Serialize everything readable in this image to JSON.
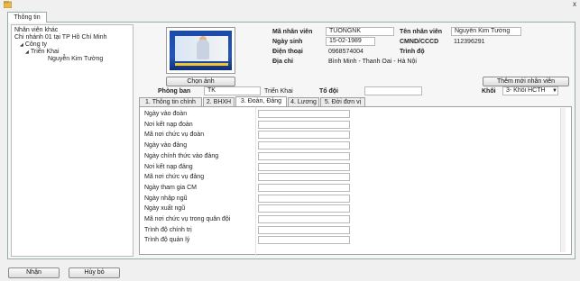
{
  "window": {
    "close_glyph": "x",
    "icon": "app-icon"
  },
  "outer_tab": "Thông tin",
  "tree": {
    "items": [
      {
        "label": "Nhân viên khác",
        "level": 0,
        "expanded": null
      },
      {
        "label": "Chi nhánh 01 tại TP Hồ Chí Minh",
        "level": 0,
        "expanded": null
      },
      {
        "label": "Công ty",
        "level": 0,
        "expanded": true
      },
      {
        "label": "Triển Khai",
        "level": 1,
        "expanded": true
      },
      {
        "label": "Nguyễn Kim Tường",
        "level": 2,
        "expanded": null
      }
    ],
    "arrow_glyph": "◢"
  },
  "photo_button": "Chọn ảnh",
  "add_employee_button": "Thêm mới nhân viên",
  "employee": {
    "ma_nv_label": "Mã nhân viên",
    "ma_nv": "TUONGNK",
    "ten_nv_label": "Tên nhân viên",
    "ten_nv": "Nguyễn Kim Tường",
    "ngay_sinh_label": "Ngày sinh",
    "ngay_sinh": "15-02-1989",
    "cmnd_label": "CMND/CCCD",
    "cmnd": "112396291",
    "dien_thoai_label": "Điện thoại",
    "dien_thoai": "0968574004",
    "trinh_do_label": "Trình độ",
    "trinh_do": "",
    "dia_chi_label": "Địa chỉ",
    "dia_chi": "Bình Minh - Thanh Oai - Hà Nội"
  },
  "org": {
    "phong_ban_label": "Phòng ban",
    "phong_ban_code": "TK",
    "phong_ban_name": "Triển Khai",
    "to_doi_label": "Tổ đội",
    "to_doi": "",
    "khoi_label": "Khối",
    "khoi": "3- Khối HCTH",
    "dropdown_glyph": "▼"
  },
  "tabs": [
    {
      "label": "1. Thông tin chính",
      "active": false
    },
    {
      "label": "2. BHXH",
      "active": false
    },
    {
      "label": "3. Đoàn, Đảng",
      "active": true
    },
    {
      "label": "4. Lương",
      "active": false
    },
    {
      "label": "5. Đời đơn vị",
      "active": false
    }
  ],
  "fields": [
    {
      "label": "Ngày vào đoàn",
      "value": ""
    },
    {
      "label": "Nơi kết nạp đoàn",
      "value": ""
    },
    {
      "label": "Mã nơi chức vụ đoàn",
      "value": ""
    },
    {
      "label": "Ngày vào đảng",
      "value": ""
    },
    {
      "label": "Ngày chính thức vào đảng",
      "value": ""
    },
    {
      "label": "Nơi kết nạp đảng",
      "value": ""
    },
    {
      "label": "Mã nơi chức vụ đảng",
      "value": ""
    },
    {
      "label": "Ngày tham gia CM",
      "value": ""
    },
    {
      "label": "Ngày nhập ngũ",
      "value": ""
    },
    {
      "label": "Ngày xuất ngũ",
      "value": ""
    },
    {
      "label": "Mã nơi chức vụ trong quân đội",
      "value": ""
    },
    {
      "label": "Trình độ chính trị",
      "value": ""
    },
    {
      "label": "Trình độ quản lý",
      "value": ""
    }
  ],
  "footer": {
    "ok_button": "Nhận",
    "cancel_button": "Hủy bỏ"
  }
}
